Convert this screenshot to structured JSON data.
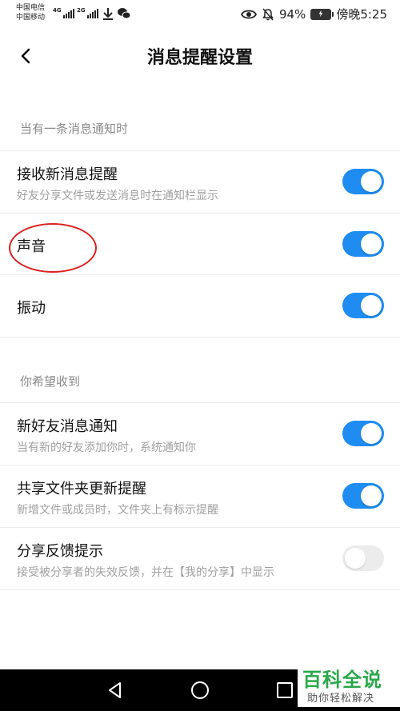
{
  "status_bar": {
    "carrier1": "中国电信",
    "carrier2": "中国移动",
    "sig1_tag": "4G",
    "sig2_tag": "2G",
    "battery_percent": "94%",
    "time": "傍晚5:25"
  },
  "header": {
    "title": "消息提醒设置"
  },
  "sections": [
    {
      "label": "当有一条消息通知时",
      "items": [
        {
          "label": "接收新消息提醒",
          "sub": "好友分享文件或发送消息时在通知栏显示",
          "enabled": true
        },
        {
          "label": "声音",
          "sub": "",
          "enabled": true
        },
        {
          "label": "振动",
          "sub": "",
          "enabled": true
        }
      ]
    },
    {
      "label": "你希望收到",
      "items": [
        {
          "label": "新好友消息通知",
          "sub": "当有新的好友添加你时，系统通知你",
          "enabled": true
        },
        {
          "label": "共享文件夹更新提醒",
          "sub": "新增文件或成员时，文件夹上有标示提醒",
          "enabled": true
        },
        {
          "label": "分享反馈提示",
          "sub": "接受被分享者的失效反馈，并在【我的分享】中显示",
          "enabled": false
        }
      ]
    }
  ],
  "watermark": {
    "brand": "百科全说",
    "slogan": "助你轻松解决"
  },
  "colors": {
    "toggle_on": "#1e8cf0",
    "toggle_off": "#ececec",
    "annotation": "#e02020",
    "watermark": "#2aa84a"
  }
}
